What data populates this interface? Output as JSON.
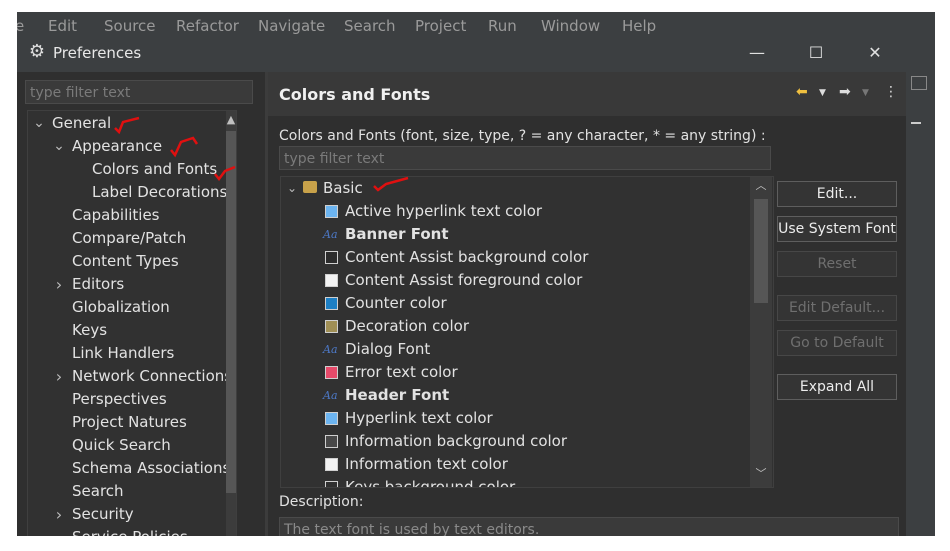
{
  "eclipse": {
    "menu": [
      "e",
      "Edit",
      "Source",
      "Refactor",
      "Navigate",
      "Search",
      "Project",
      "Run",
      "Window",
      "Help"
    ]
  },
  "dialog": {
    "title": "Preferences",
    "window_buttons": {
      "minimize": "—",
      "maximize": "☐",
      "close": "✕"
    }
  },
  "left": {
    "filter_placeholder": "type filter text",
    "tree": [
      {
        "label": "General",
        "twistie": "expanded",
        "level": 0
      },
      {
        "label": "Appearance",
        "twistie": "expanded",
        "level": 1
      },
      {
        "label": "Colors and Fonts",
        "twistie": "none",
        "level": 2
      },
      {
        "label": "Label Decorations",
        "twistie": "none",
        "level": 2
      },
      {
        "label": "Capabilities",
        "twistie": "none",
        "level": 1
      },
      {
        "label": "Compare/Patch",
        "twistie": "none",
        "level": 1
      },
      {
        "label": "Content Types",
        "twistie": "none",
        "level": 1
      },
      {
        "label": "Editors",
        "twistie": "collapsed",
        "level": 1
      },
      {
        "label": "Globalization",
        "twistie": "none",
        "level": 1
      },
      {
        "label": "Keys",
        "twistie": "none",
        "level": 1
      },
      {
        "label": "Link Handlers",
        "twistie": "none",
        "level": 1
      },
      {
        "label": "Network Connections",
        "twistie": "collapsed",
        "level": 1
      },
      {
        "label": "Perspectives",
        "twistie": "none",
        "level": 1
      },
      {
        "label": "Project Natures",
        "twistie": "none",
        "level": 1
      },
      {
        "label": "Quick Search",
        "twistie": "none",
        "level": 1
      },
      {
        "label": "Schema Associations",
        "twistie": "none",
        "level": 1
      },
      {
        "label": "Search",
        "twistie": "none",
        "level": 1
      },
      {
        "label": "Security",
        "twistie": "collapsed",
        "level": 1
      },
      {
        "label": "Service Policies",
        "twistie": "none",
        "level": 1
      }
    ]
  },
  "right": {
    "header": "Colors and Fonts",
    "prompt": "Colors and Fonts (font, size, type, ? = any character, * = any string) :",
    "filter_placeholder": "type filter text",
    "category": "Basic",
    "items": [
      {
        "label": "Active hyperlink text color",
        "kind": "color",
        "color": "#6cb4f0",
        "bold": false
      },
      {
        "label": "Banner Font",
        "kind": "font",
        "bold": true
      },
      {
        "label": "Content Assist background color",
        "kind": "color",
        "color": "#2b2b2b",
        "bold": false
      },
      {
        "label": "Content Assist foreground color",
        "kind": "color",
        "color": "#f2f2f2",
        "bold": false
      },
      {
        "label": "Counter color",
        "kind": "color",
        "color": "#1d7fc4",
        "bold": false
      },
      {
        "label": "Decoration color",
        "kind": "color",
        "color": "#a08f55",
        "bold": false
      },
      {
        "label": "Dialog Font",
        "kind": "font",
        "bold": false
      },
      {
        "label": "Error text color",
        "kind": "color",
        "color": "#e64a6a",
        "bold": false
      },
      {
        "label": "Header Font",
        "kind": "font",
        "bold": true
      },
      {
        "label": "Hyperlink text color",
        "kind": "color",
        "color": "#6cb4f0",
        "bold": false
      },
      {
        "label": "Information background color",
        "kind": "color",
        "color": "#484848",
        "bold": false
      },
      {
        "label": "Information text color",
        "kind": "color",
        "color": "#f2f2f2",
        "bold": false
      },
      {
        "label": "Keys background color",
        "kind": "color",
        "color": "#2f2f2f",
        "bold": false
      }
    ],
    "buttons": [
      {
        "label": "Edit...",
        "enabled": true
      },
      {
        "label": "Use System Font",
        "enabled": true
      },
      {
        "label": "Reset",
        "enabled": false
      },
      {
        "label": "Edit Default...",
        "enabled": false
      },
      {
        "label": "Go to Default",
        "enabled": false
      },
      {
        "label": "Expand All",
        "enabled": true
      }
    ],
    "description_label": "Description:",
    "description": "The text font is used by text editors."
  },
  "colors": {
    "annotation": "#e01010"
  }
}
